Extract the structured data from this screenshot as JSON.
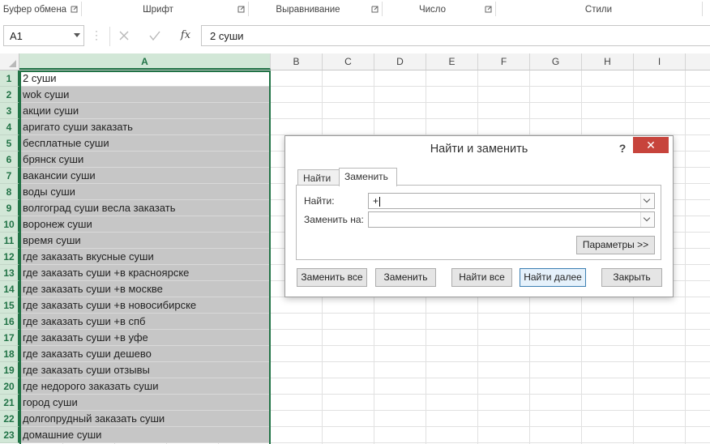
{
  "ribbon": {
    "groups": [
      "Буфер обмена",
      "Шрифт",
      "Выравнивание",
      "Число",
      "Стили"
    ]
  },
  "formula_bar": {
    "name_box": "A1",
    "content": "2 суши",
    "cancel_icon": "close-icon",
    "enter_icon": "check-icon",
    "fx_label": "fx"
  },
  "columns": [
    "A",
    "B",
    "C",
    "D",
    "E",
    "F",
    "G",
    "H",
    "I"
  ],
  "rows": [
    {
      "num": "1",
      "a": "2 суши"
    },
    {
      "num": "2",
      "a": "wok суши"
    },
    {
      "num": "3",
      "a": "акции суши"
    },
    {
      "num": "4",
      "a": "аригато суши заказать"
    },
    {
      "num": "5",
      "a": "бесплатные суши"
    },
    {
      "num": "6",
      "a": "брянск суши"
    },
    {
      "num": "7",
      "a": "вакансии суши"
    },
    {
      "num": "8",
      "a": "воды суши"
    },
    {
      "num": "9",
      "a": "волгоград суши весла заказать"
    },
    {
      "num": "10",
      "a": "воронеж суши"
    },
    {
      "num": "11",
      "a": "время суши"
    },
    {
      "num": "12",
      "a": "где заказать вкусные суши"
    },
    {
      "num": "13",
      "a": "где заказать суши +в красноярске"
    },
    {
      "num": "14",
      "a": "где заказать суши +в москве"
    },
    {
      "num": "15",
      "a": "где заказать суши +в новосибирске"
    },
    {
      "num": "16",
      "a": "где заказать суши +в спб"
    },
    {
      "num": "17",
      "a": "где заказать суши +в уфе"
    },
    {
      "num": "18",
      "a": "где заказать суши дешево"
    },
    {
      "num": "19",
      "a": "где заказать суши отзывы"
    },
    {
      "num": "20",
      "a": "где недорого заказать суши"
    },
    {
      "num": "21",
      "a": "город суши"
    },
    {
      "num": "22",
      "a": "долгопрудный заказать суши"
    },
    {
      "num": "23",
      "a": "домашние суши"
    }
  ],
  "dialog": {
    "title": "Найти и заменить",
    "help": "?",
    "close": "✕",
    "tabs": {
      "find": "Найти",
      "replace": "Заменить"
    },
    "find_label": "Найти:",
    "find_value": "+",
    "replace_label": "Заменить на:",
    "replace_value": "",
    "options_button": "Параметры >>",
    "buttons": {
      "replace_all": "Заменить все",
      "replace": "Заменить",
      "find_all": "Найти все",
      "find_next": "Найти далее",
      "close": "Закрыть"
    }
  },
  "colors": {
    "accent": "#217346",
    "selected_column_bg": "#c6c6c6",
    "close_button": "#c7443c"
  }
}
